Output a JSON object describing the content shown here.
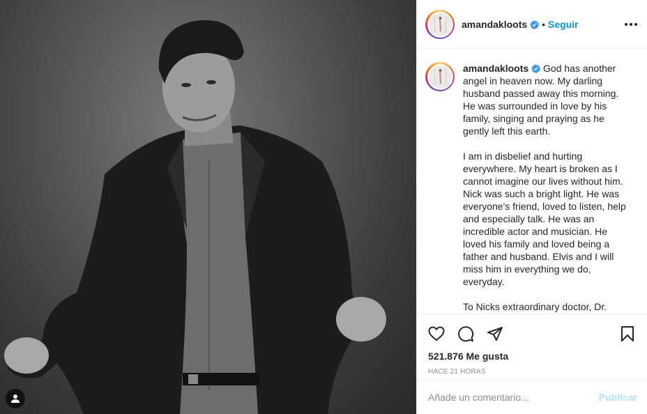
{
  "post": {
    "username": "amandakloots",
    "follow_label": "Seguir",
    "separator": "•",
    "caption_paragraphs": [
      "God has another angel in heaven now. My darling husband passed away this morning. He was surrounded in love by his family, singing and praying as he gently left this earth.",
      "I am in disbelief and hurting everywhere. My heart is broken as I cannot imagine our lives without him. Nick was such a bright light. He was everyone's friend, loved to listen, help and especially talk. He was an incredible actor and musician. He loved his family and loved being a father and husband. Elvis and I will miss him in everything we do, everyday.",
      "To Nicks extraordinary doctor, Dr."
    ],
    "likes": "521.876 Me gusta",
    "timestamp": "HACE 21 HORAS",
    "comment_placeholder": "Añade un comentario...",
    "publish_label": "Publicar"
  },
  "colors": {
    "accent": "#0095f6",
    "publish_disabled": "#b2dffc",
    "muted": "#8e8e8e",
    "text": "#262626",
    "border": "#efefef"
  },
  "icons": [
    "heart-icon",
    "comment-icon",
    "share-icon",
    "bookmark-icon",
    "verified-icon",
    "more-options-icon",
    "user-tag-icon"
  ]
}
